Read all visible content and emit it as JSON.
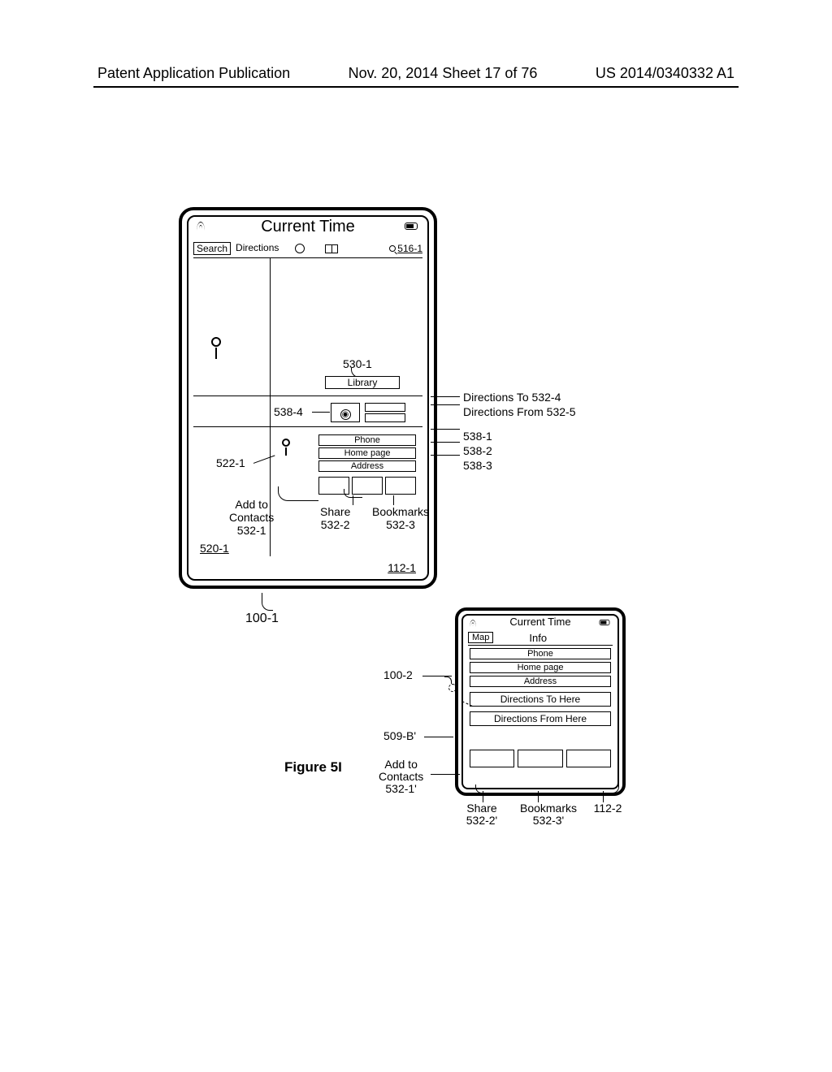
{
  "header": {
    "left": "Patent Application Publication",
    "center": "Nov. 20, 2014  Sheet 17 of 76",
    "right": "US 2014/0340332 A1"
  },
  "figure_label": "Figure 5I",
  "device1": {
    "status_title": "Current Time",
    "toolbar": {
      "search": "Search",
      "directions": "Directions",
      "search_ref": "516-1"
    },
    "callout_library": "Library",
    "ref_530_1": "530-1",
    "ref_538_4": "538-4",
    "rows": {
      "phone": "Phone",
      "homepage": "Home page",
      "address": "Address"
    },
    "ref_522_1": "522-1",
    "add_to_contacts": "Add to\nContacts\n532-1",
    "share": "Share\n532-2",
    "bookmarks": "Bookmarks\n532-3",
    "ref_520_1": "520-1",
    "ref_112_1": "112-1",
    "ref_100_1": "100-1"
  },
  "external_right": {
    "a": "Directions To 532-4",
    "b": "Directions From 532-5",
    "c": "538-1",
    "d": "538-2",
    "e": "538-3"
  },
  "device2": {
    "status_title": "Current Time",
    "map_btn": "Map",
    "info": "Info",
    "rows": {
      "phone": "Phone",
      "homepage": "Home page",
      "address": "Address",
      "dir_to": "Directions To Here",
      "dir_from": "Directions From Here"
    },
    "ref_100_2": "100-2",
    "ref_509b": "509-B'",
    "add_to_contacts": "Add to\nContacts\n532-1'",
    "share": "Share\n532-2'",
    "bookmarks": "Bookmarks\n532-3'",
    "ref_112_2": "112-2"
  }
}
